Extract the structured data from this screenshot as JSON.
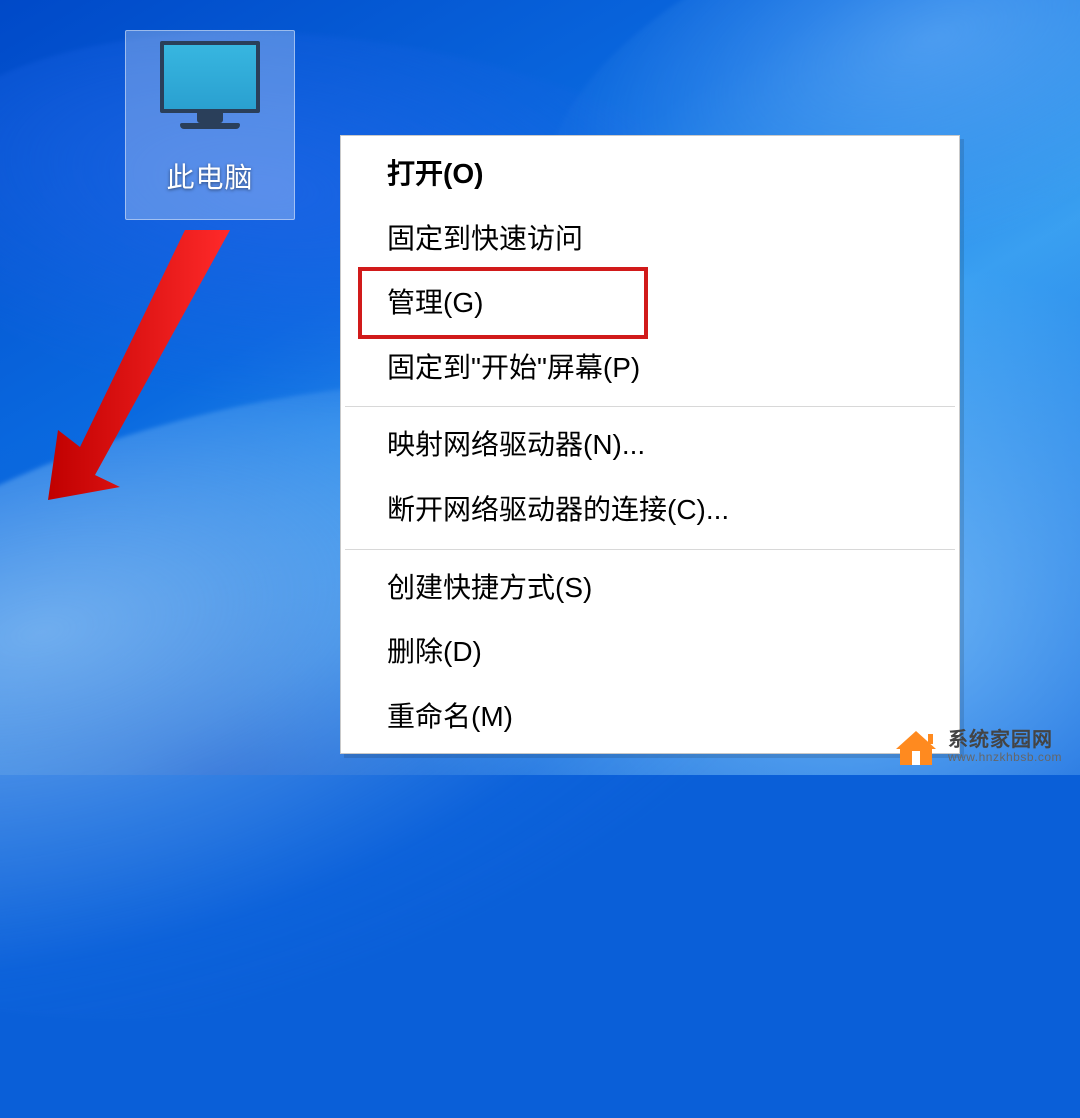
{
  "desktop": {
    "icon_label": "此电脑"
  },
  "context_menu": {
    "items": [
      {
        "label": "打开(O)",
        "bold": true
      },
      {
        "label": "固定到快速访问"
      },
      {
        "label": "管理(G)",
        "highlighted": true
      },
      {
        "label": "固定到\"开始\"屏幕(P)"
      }
    ],
    "group2": [
      {
        "label": "映射网络驱动器(N)..."
      },
      {
        "label": "断开网络驱动器的连接(C)..."
      }
    ],
    "group3": [
      {
        "label": "创建快捷方式(S)"
      },
      {
        "label": "删除(D)"
      },
      {
        "label": "重命名(M)"
      }
    ]
  },
  "watermark": {
    "title": "系统家园网",
    "url": "www.hnzkhbsb.com"
  }
}
